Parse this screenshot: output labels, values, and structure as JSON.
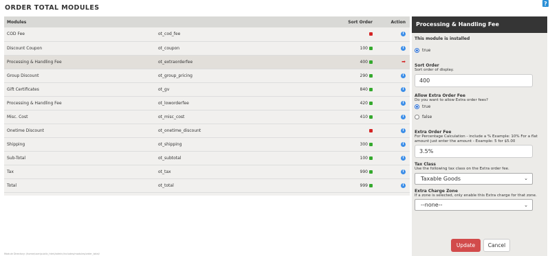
{
  "page": {
    "title": "Order Total Modules",
    "help": "?"
  },
  "table": {
    "headers": {
      "modules": "Modules",
      "sort_order": "Sort Order",
      "action": "Action"
    },
    "rows": [
      {
        "name": "COD Fee",
        "code": "ot_cod_fee",
        "sort": "",
        "status": "red",
        "action": "info"
      },
      {
        "name": "Discount Coupon",
        "code": "ot_coupon",
        "sort": "100",
        "status": "green",
        "action": "info"
      },
      {
        "name": "Processing & Handling Fee",
        "code": "ot_extraorderfee",
        "sort": "400",
        "status": "green",
        "action": "arrow",
        "selected": true
      },
      {
        "name": "Group Discount",
        "code": "ot_group_pricing",
        "sort": "290",
        "status": "green",
        "action": "info"
      },
      {
        "name": "Gift Certificates",
        "code": "ot_gv",
        "sort": "840",
        "status": "green",
        "action": "info"
      },
      {
        "name": "Processing & Handling Fee",
        "code": "ot_loworderfee",
        "sort": "420",
        "status": "green",
        "action": "info"
      },
      {
        "name": "Misc. Cost",
        "code": "ot_misc_cost",
        "sort": "410",
        "status": "green",
        "action": "info"
      },
      {
        "name": "Onetime Discount",
        "code": "ot_onetime_discount",
        "sort": "",
        "status": "red",
        "action": "info"
      },
      {
        "name": "Shipping",
        "code": "ot_shipping",
        "sort": "300",
        "status": "green",
        "action": "info"
      },
      {
        "name": "Sub-Total",
        "code": "ot_subtotal",
        "sort": "100",
        "status": "green",
        "action": "info"
      },
      {
        "name": "Tax",
        "code": "ot_tax",
        "sort": "990",
        "status": "green",
        "action": "info"
      },
      {
        "name": "Total",
        "code": "ot_total",
        "sort": "999",
        "status": "green",
        "action": "info"
      }
    ]
  },
  "panel": {
    "title": "Processing & Handling Fee",
    "installed_note": "This module is installed",
    "installed_option": "true",
    "sort_order": {
      "title": "Sort Order",
      "desc": "Sort order of display.",
      "value": "400"
    },
    "allow_fee": {
      "title": "Allow Extra Order Fee",
      "desc": "Do you want to allow Extra order fees?",
      "option_true": "true",
      "option_false": "false"
    },
    "extra_fee": {
      "title": "Extra Order Fee",
      "desc": "For Percentage Calculation - include a % Example: 10% For a flat amount just enter the amount - Example: 5 for $5.00",
      "value": "3.5%"
    },
    "tax_class": {
      "title": "Tax Class",
      "desc": "Use the following tax class on the Extra order fee.",
      "value": "Taxable Goods"
    },
    "charge_zone": {
      "title": "Extra Charge Zone",
      "desc": "If a zone is selected, only enable this Extra charge for that zone.",
      "value": "--none--"
    },
    "update_label": "Update",
    "cancel_label": "Cancel"
  },
  "colors": {
    "accent_red": "#d24b4b",
    "status_green": "#35a92e",
    "status_red": "#d42525",
    "info_blue": "#3c8ee8"
  }
}
